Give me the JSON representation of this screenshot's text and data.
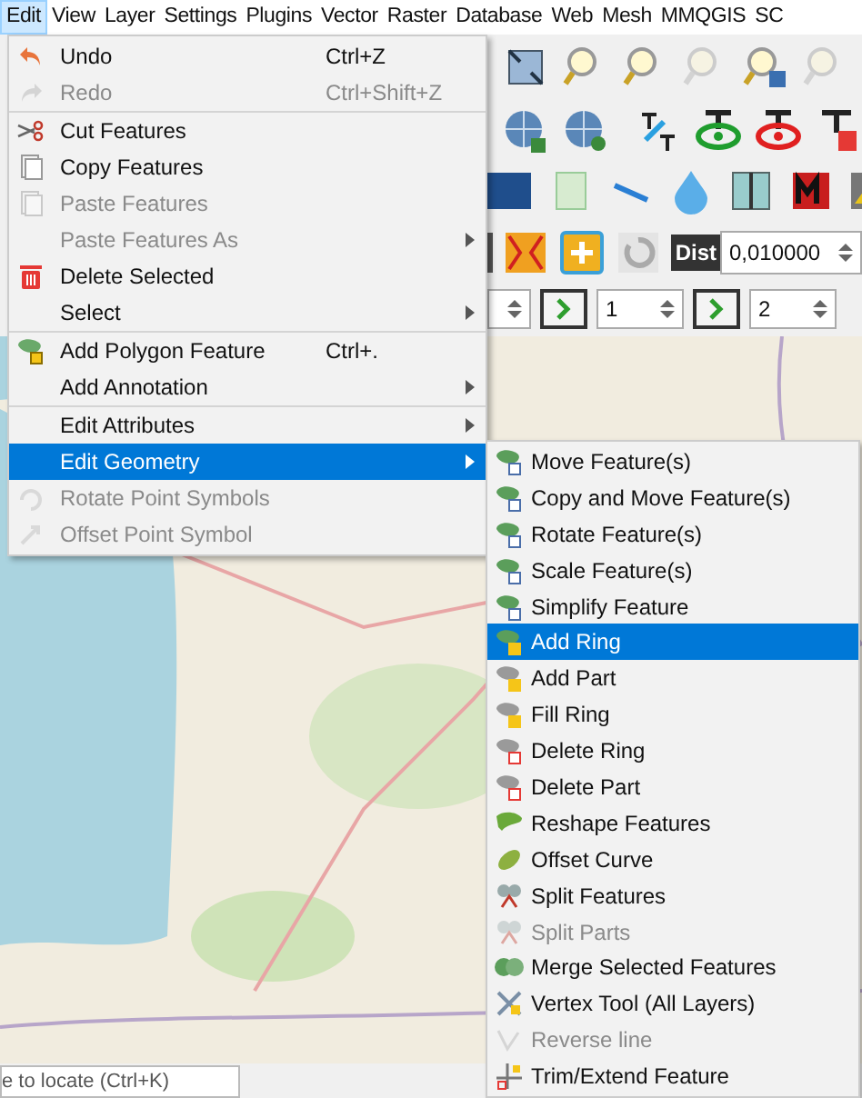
{
  "menu_bar": [
    {
      "label": "Edit",
      "selected": true
    },
    {
      "label": "View",
      "selected": false
    },
    {
      "label": "Layer",
      "selected": false
    },
    {
      "label": "Settings",
      "selected": false
    },
    {
      "label": "Plugins",
      "selected": false
    },
    {
      "label": "Vector",
      "selected": false
    },
    {
      "label": "Raster",
      "selected": false
    },
    {
      "label": "Database",
      "selected": false
    },
    {
      "label": "Web",
      "selected": false
    },
    {
      "label": "Mesh",
      "selected": false
    },
    {
      "label": "MMQGIS",
      "selected": false
    },
    {
      "label": "SC",
      "selected": false
    }
  ],
  "edit_menu": {
    "groups": [
      [
        {
          "label": "Undo",
          "shortcut": "Ctrl+Z",
          "disabled": false,
          "submenu": false,
          "selected": false
        },
        {
          "label": "Redo",
          "shortcut": "Ctrl+Shift+Z",
          "disabled": true,
          "submenu": false,
          "selected": false
        }
      ],
      [
        {
          "label": "Cut Features",
          "disabled": false,
          "submenu": false,
          "selected": false
        },
        {
          "label": "Copy Features",
          "disabled": false,
          "submenu": false,
          "selected": false
        },
        {
          "label": "Paste Features",
          "disabled": true,
          "submenu": false,
          "selected": false
        },
        {
          "label": "Paste Features As",
          "disabled": true,
          "submenu": true,
          "selected": false
        },
        {
          "label": "Delete Selected",
          "disabled": false,
          "submenu": false,
          "selected": false
        },
        {
          "label": "Select",
          "disabled": false,
          "submenu": true,
          "selected": false
        }
      ],
      [
        {
          "label": "Add Polygon Feature",
          "shortcut": "Ctrl+.",
          "disabled": false,
          "submenu": false,
          "selected": false
        },
        {
          "label": "Add Annotation",
          "disabled": false,
          "submenu": true,
          "selected": false
        }
      ],
      [
        {
          "label": "Edit Attributes",
          "disabled": false,
          "submenu": true,
          "selected": false
        },
        {
          "label": "Edit Geometry",
          "disabled": false,
          "submenu": true,
          "selected": true
        },
        {
          "label": "Rotate Point Symbols",
          "disabled": true,
          "submenu": false,
          "selected": false
        },
        {
          "label": "Offset Point Symbol",
          "disabled": true,
          "submenu": false,
          "selected": false
        }
      ]
    ]
  },
  "geometry_submenu": [
    {
      "label": "Move Feature(s)",
      "disabled": false,
      "selected": false
    },
    {
      "label": "Copy and Move Feature(s)",
      "disabled": false,
      "selected": false
    },
    {
      "label": "Rotate Feature(s)",
      "disabled": false,
      "selected": false
    },
    {
      "label": "Scale Feature(s)",
      "disabled": false,
      "selected": false
    },
    {
      "label": "Simplify Feature",
      "disabled": false,
      "selected": false
    },
    {
      "label": "Add Ring",
      "disabled": false,
      "selected": true
    },
    {
      "label": "Add Part",
      "disabled": false,
      "selected": false
    },
    {
      "label": "Fill Ring",
      "disabled": false,
      "selected": false
    },
    {
      "label": "Delete Ring",
      "disabled": false,
      "selected": false
    },
    {
      "label": "Delete Part",
      "disabled": false,
      "selected": false
    },
    {
      "label": "Reshape Features",
      "disabled": false,
      "selected": false
    },
    {
      "label": "Offset Curve",
      "disabled": false,
      "selected": false
    },
    {
      "label": "Split Features",
      "disabled": false,
      "selected": false
    },
    {
      "label": "Split Parts",
      "disabled": true,
      "selected": false
    },
    {
      "label": "Merge Selected Features",
      "disabled": false,
      "selected": false
    },
    {
      "label": "Vertex Tool (All Layers)",
      "disabled": false,
      "selected": false
    },
    {
      "label": "Reverse line",
      "disabled": true,
      "selected": false
    },
    {
      "label": "Trim/Extend Feature",
      "disabled": false,
      "selected": false
    }
  ],
  "toolbar": {
    "distance_label": "Dist",
    "distance_value": "0,010000",
    "spin_values": [
      "1",
      "2"
    ]
  },
  "status_bar": {
    "locator": {
      "placeholder": "e to locate (Ctrl+K)"
    }
  }
}
